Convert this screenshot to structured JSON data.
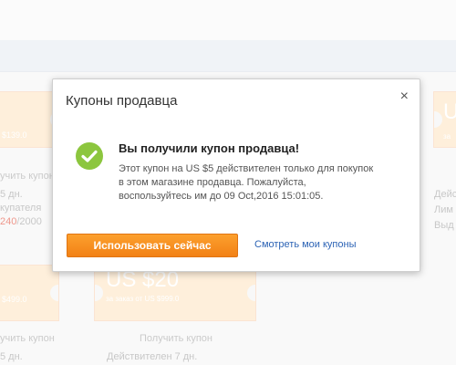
{
  "background": {
    "left_coupon_top": {
      "amount": "$139.0"
    },
    "left_labels": {
      "get": "учить купон",
      "valid": "5 дн.",
      "buyer": "купателя",
      "used_red": "240",
      "used_total": "/2000"
    },
    "left_coupon_bottom": {
      "amount": "$499.0"
    },
    "left_labels_bottom": {
      "get": "учить купон",
      "valid": "5 дн."
    },
    "mid_coupon": {
      "amount": "US $20",
      "min": "за заказ от US $999.0"
    },
    "mid_labels": {
      "get": "Получить купон",
      "valid": "Действителен 7 дн."
    },
    "right_coupon": {
      "amount": "U",
      "min": "за"
    },
    "right_labels": {
      "valid": "Дейс",
      "limit": "Лим",
      "issued": "Выд"
    }
  },
  "modal": {
    "title": "Купоны продавца",
    "close": "×",
    "heading": "Вы получили купон продавца!",
    "desc_line1": "Этот купон на US $5 действителен только для покупок",
    "desc_line2": "в этом магазине продавца. Пожалуйста,",
    "desc_line3": "воспользуйтесь им до 09 Oct,2016 15:01:05.",
    "use_button": "Использовать сейчас",
    "my_coupons_link": "Смотреть мои купоны",
    "accent": "#f28116",
    "success": "#8cc63e",
    "link_color": "#2c63b5"
  }
}
